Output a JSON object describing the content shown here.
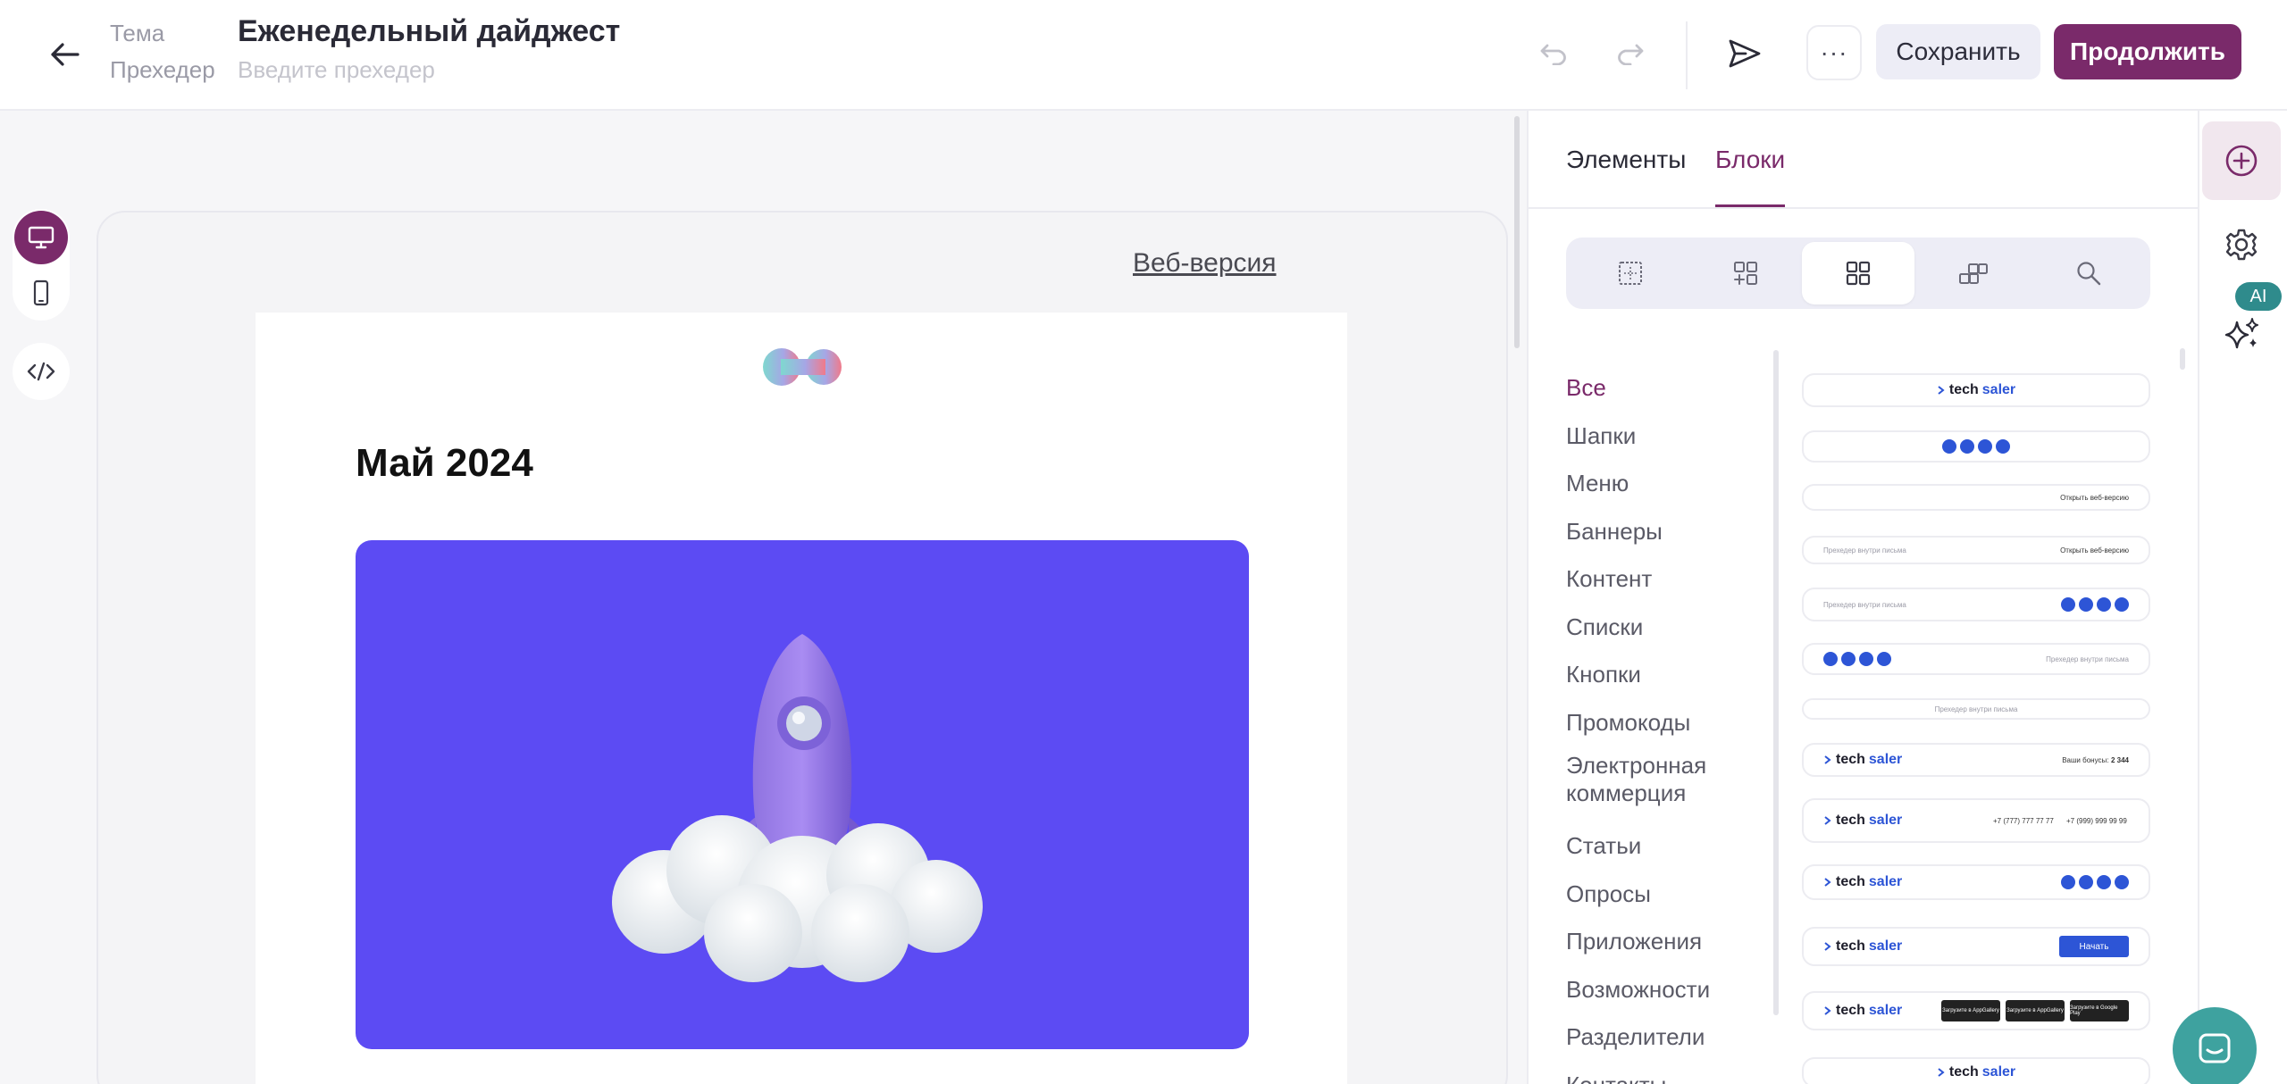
{
  "header": {
    "theme_label": "Тема",
    "title": "Еженедельный дайджест",
    "preheader_label": "Прехедер",
    "preheader_placeholder": "Введите прехедер",
    "save_label": "Сохранить",
    "continue_label": "Продолжить",
    "more_label": "···"
  },
  "canvas": {
    "web_version_link": "Веб-версия",
    "email_title": "Май 2024"
  },
  "panel": {
    "tabs": [
      {
        "label": "Элементы",
        "active": false
      },
      {
        "label": "Блоки",
        "active": true
      }
    ],
    "segment_icons": [
      "layout-grid-icon",
      "add-grid-icon",
      "blocks-grid-icon",
      "stacked-blocks-icon",
      "search-icon"
    ],
    "categories": [
      {
        "label": "Все",
        "active": true
      },
      {
        "label": "Шапки"
      },
      {
        "label": "Меню"
      },
      {
        "label": "Баннеры"
      },
      {
        "label": "Контент"
      },
      {
        "label": "Списки"
      },
      {
        "label": "Кнопки"
      },
      {
        "label": "Промокоды"
      },
      {
        "label": "Электронная коммерция"
      },
      {
        "label": "Статьи"
      },
      {
        "label": "Опросы"
      },
      {
        "label": "Приложения"
      },
      {
        "label": "Возможности"
      },
      {
        "label": "Разделители"
      },
      {
        "label": "Контакты"
      }
    ],
    "block_previews": {
      "logo_text_a": "tech",
      "logo_text_b": "saler",
      "web_link": "Открыть веб-версию",
      "promo_text": "Прехедер внутри письма",
      "bonus_text": "Ваши бонусы:",
      "bonus_value": "2 344",
      "phone_1": "+7 (777) 777 77 77",
      "phone_2": "+7 (999) 999 99 99",
      "start_button": "Начать",
      "store_1": "Загрузите в AppGallery",
      "store_2": "Загрузите в AppGallery",
      "store_3": "Загрузите в Google Play"
    }
  },
  "rail": {
    "ai_badge": "AI"
  },
  "colors": {
    "accent": "#7a2a6a",
    "hero_bg": "#5c4bf3",
    "brand_blue": "#2d55d6",
    "chat": "#3ea29f"
  }
}
